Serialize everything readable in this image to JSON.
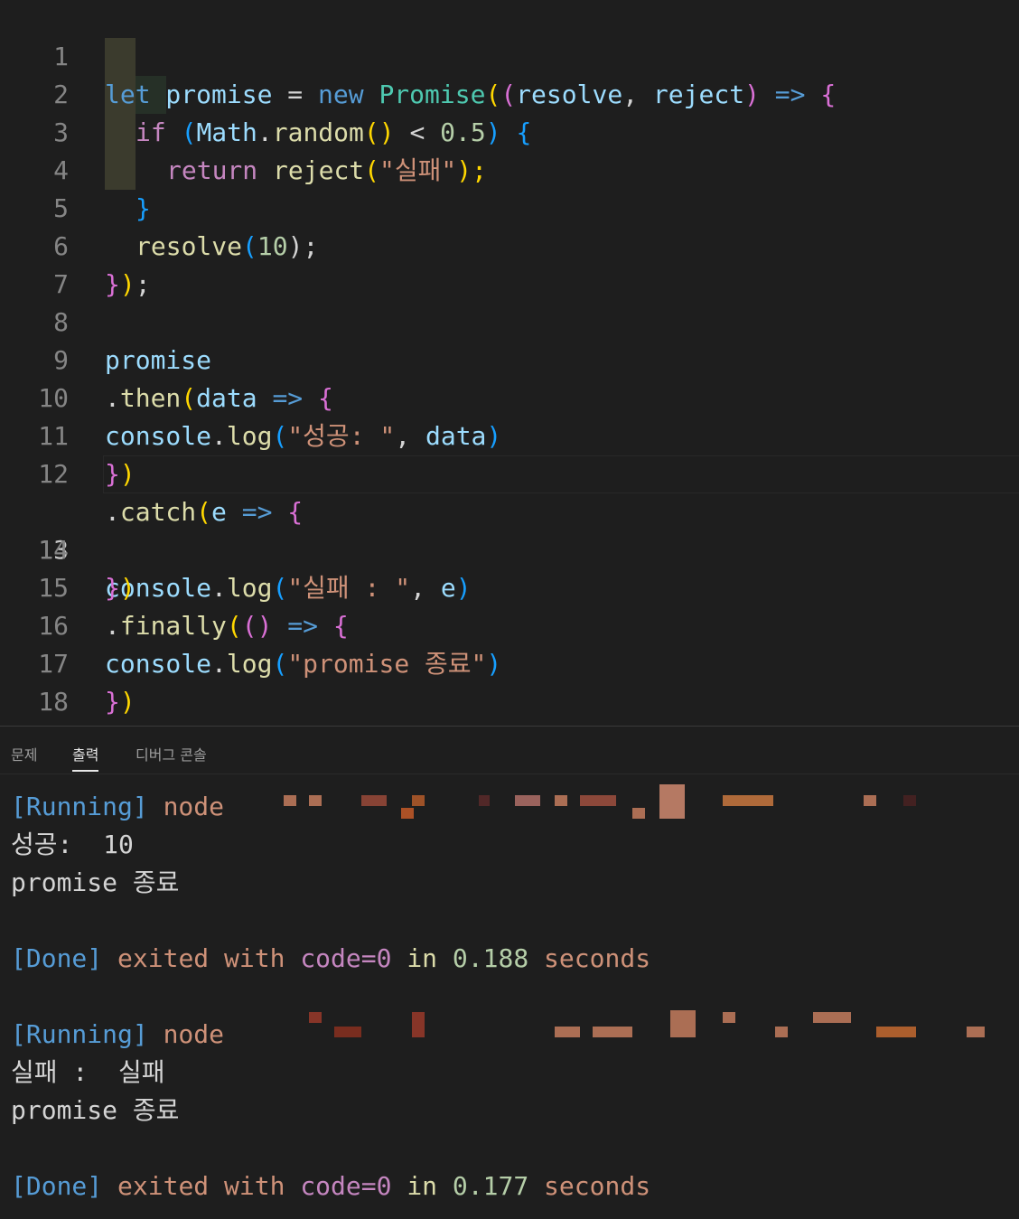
{
  "editor": {
    "lines": [
      {
        "n": "1"
      },
      {
        "n": "2"
      },
      {
        "n": "3"
      },
      {
        "n": "4"
      },
      {
        "n": "5"
      },
      {
        "n": "6"
      },
      {
        "n": "7"
      },
      {
        "n": "8"
      },
      {
        "n": "9"
      },
      {
        "n": "10"
      },
      {
        "n": "11"
      },
      {
        "n": "12"
      },
      {
        "n": "13"
      },
      {
        "n": "14"
      },
      {
        "n": "15"
      },
      {
        "n": "16"
      },
      {
        "n": "17"
      },
      {
        "n": "18"
      }
    ],
    "active_line": "13",
    "tokens": {
      "l1": [
        "let",
        " promise",
        " =",
        " new",
        " Promise",
        "(",
        "(",
        "resolve",
        ", ",
        "reject",
        ")",
        " =>",
        " {"
      ],
      "l2": [
        "if",
        " (",
        "Math",
        ".",
        "random",
        "()",
        " <",
        " 0.5",
        ")",
        " {"
      ],
      "l3": [
        "return",
        " reject",
        "(",
        "\"실패\"",
        ");"
      ],
      "l4": [
        "}"
      ],
      "l5": [
        "resolve",
        "(",
        "10",
        ");"
      ],
      "l6": [
        "}",
        ")",
        ";"
      ],
      "l8": [
        "promise"
      ],
      "l9": [
        ".",
        "then",
        "(",
        "data",
        " =>",
        " {"
      ],
      "l10": [
        "console",
        ".",
        "log",
        "(",
        "\"성공: \"",
        ", ",
        "data",
        ")"
      ],
      "l11": [
        "}",
        ")"
      ],
      "l12": [
        ".",
        "catch",
        "(",
        "e",
        " =>",
        " {"
      ],
      "l13": [
        "console",
        ".",
        "log",
        "(",
        "\"실패 : \"",
        ", ",
        "e",
        ")"
      ],
      "l14": [
        "}",
        ")"
      ],
      "l15": [
        ".",
        "finally",
        "(",
        "()",
        " =>",
        " {"
      ],
      "l16": [
        "console",
        ".",
        "log",
        "(",
        "\"promise 종료\"",
        ")"
      ],
      "l17": [
        "}",
        ")"
      ]
    }
  },
  "panel": {
    "tabs": [
      "문제",
      "출력",
      "디버그 콘솔"
    ],
    "active_tab": "출력",
    "output": {
      "run1_label": "[Running]",
      "run1_cmd": " node",
      "out1a": "성공:  10",
      "out1b": "promise 종료",
      "done1": [
        "[Done]",
        " exited with ",
        "code=0",
        " in ",
        "0.188",
        " seconds"
      ],
      "run2_label": "[Running]",
      "run2_cmd": " node",
      "out2a": "실패 :  실패",
      "out2b": "promise 종료",
      "done2": [
        "[Done]",
        " exited with ",
        "code=0",
        " in ",
        "0.177",
        " seconds"
      ]
    }
  }
}
